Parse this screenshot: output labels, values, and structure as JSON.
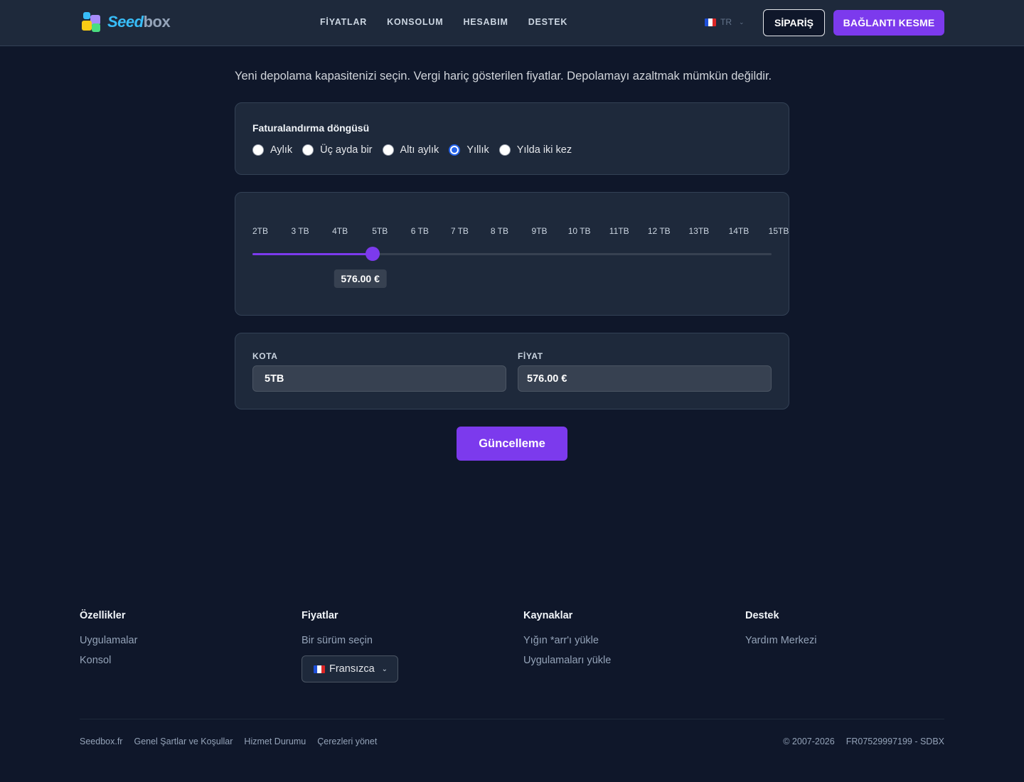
{
  "header": {
    "logo_part1": "Seed",
    "logo_part2": "box",
    "nav": [
      "FİYATLAR",
      "KONSOLUM",
      "HESABIM",
      "DESTEK"
    ],
    "lang": "TR",
    "order_label": "SİPARİŞ",
    "logout_label": "BAĞLANTI KESME"
  },
  "intro": "Yeni depolama kapasitenizi seçin. Vergi hariç gösterilen fiyatlar. Depolamayı azaltmak mümkün değildir.",
  "billing": {
    "title": "Faturalandırma döngüsü",
    "options": [
      "Aylık",
      "Üç ayda bir",
      "Altı aylık",
      "Yıllık",
      "Yılda iki kez"
    ],
    "selected_index": 3
  },
  "slider": {
    "ticks": [
      "2TB",
      "3 TB",
      "4TB",
      "5TB",
      "6 TB",
      "7 TB",
      "8 TB",
      "9TB",
      "10 TB",
      "11TB",
      "12 TB",
      "13TB",
      "14TB",
      "15TB"
    ],
    "selected_index": 3,
    "value_fraction": 0.231,
    "price": "576.00 €"
  },
  "quota": {
    "quota_label": "KOTA",
    "quota_value": "5TB",
    "price_label": "FİYAT",
    "price_value": "576.00 €"
  },
  "update_label": "Güncelleme",
  "footer": {
    "col1": {
      "title": "Özellikler",
      "links": [
        "Uygulamalar",
        "Konsol"
      ]
    },
    "col2": {
      "title": "Fiyatlar",
      "links": [
        "Bir sürüm seçin"
      ],
      "lang_select": "Fransızca"
    },
    "col3": {
      "title": "Kaynaklar",
      "links": [
        "Yığın *arr'ı yükle",
        "Uygulamaları yükle"
      ]
    },
    "col4": {
      "title": "Destek",
      "links": [
        "Yardım Merkezi"
      ]
    },
    "bottom_links": [
      "Seedbox.fr",
      "Genel Şartlar ve Koşullar",
      "Hizmet Durumu",
      "Çerezleri yönet"
    ],
    "copyright": "© 2007-2026",
    "company_id": "FR07529997199 - SDBX"
  },
  "colors": {
    "accent": "#7c3aed",
    "background": "#0f172a",
    "card": "#1e293b",
    "radio_checked": "#2563eb"
  }
}
